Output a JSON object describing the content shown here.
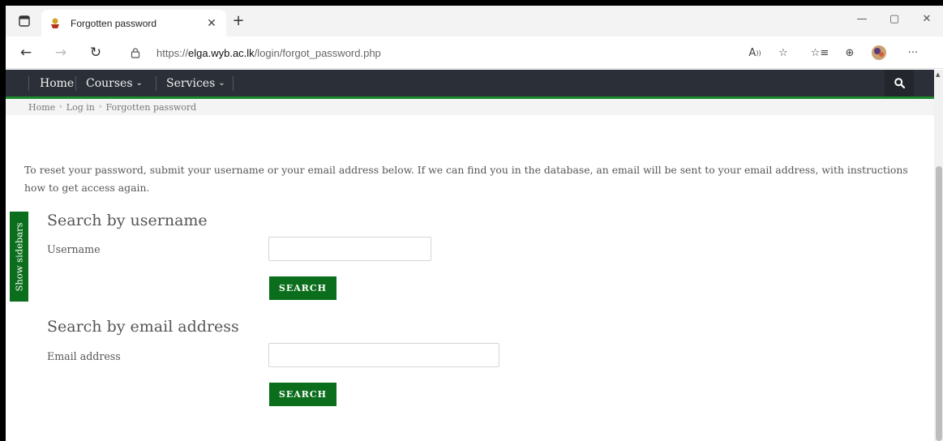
{
  "browser": {
    "tab_title": "Forgotten password",
    "url_prefix": "https://",
    "url_domain": "elga.wyb.ac.lk",
    "url_path": "/login/forgot_password.php"
  },
  "navbar": {
    "items": [
      {
        "label": "Home"
      },
      {
        "label": "Courses"
      },
      {
        "label": "Services"
      }
    ]
  },
  "breadcrumb": [
    "Home",
    "Log in",
    "Forgotten password"
  ],
  "page": {
    "intro": "To reset your password, submit your username or your email address below. If we can find you in the database, an email will be sent to your email address, with instructions how to get access again.",
    "username_section": {
      "heading": "Search by username",
      "label": "Username",
      "value": "",
      "button": "SEARCH"
    },
    "email_section": {
      "heading": "Search by email address",
      "label": "Email address",
      "value": "",
      "button": "SEARCH"
    },
    "sidebar_toggle": "Show sidebars"
  },
  "colors": {
    "navbar_bg": "#2b2f38",
    "accent_green": "#0b6e1c",
    "navbar_border": "#1a8a2b"
  }
}
